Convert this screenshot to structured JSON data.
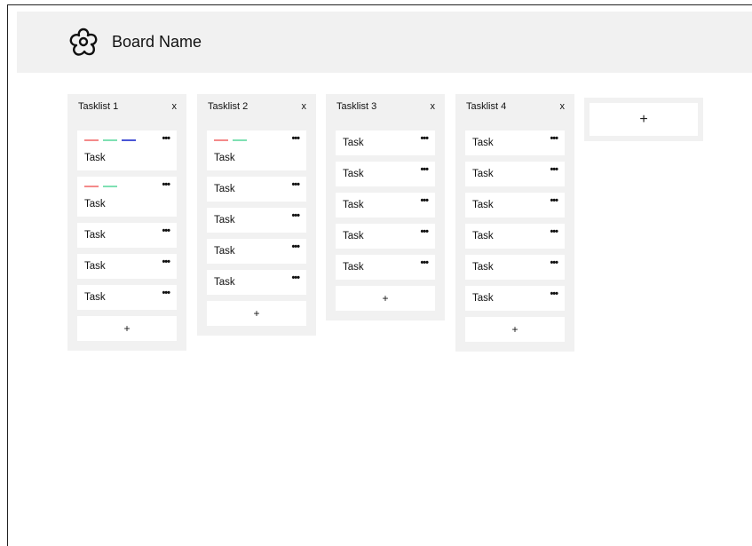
{
  "board": {
    "name": "Board Name",
    "icon": "flower-icon"
  },
  "colors": {
    "red": "#f48a8a",
    "green": "#7fe0b3",
    "blue": "#4a56d6",
    "panel": "#f1f1f1"
  },
  "tasklists": [
    {
      "title": "Tasklist 1",
      "close": "x",
      "add": "+",
      "tasks": [
        {
          "text": "Task",
          "menu": "•••",
          "labels": [
            "#f48a8a",
            "#7fe0b3",
            "#4a56d6"
          ]
        },
        {
          "text": "Task",
          "menu": "•••",
          "labels": [
            "#f48a8a",
            "#7fe0b3"
          ]
        },
        {
          "text": "Task",
          "menu": "•••",
          "labels": []
        },
        {
          "text": "Task",
          "menu": "•••",
          "labels": []
        },
        {
          "text": "Task",
          "menu": "•••",
          "labels": []
        }
      ]
    },
    {
      "title": "Tasklist 2",
      "close": "x",
      "add": "+",
      "tasks": [
        {
          "text": "Task",
          "menu": "•••",
          "labels": [
            "#f48a8a",
            "#7fe0b3"
          ]
        },
        {
          "text": "Task",
          "menu": "•••",
          "labels": []
        },
        {
          "text": "Task",
          "menu": "•••",
          "labels": []
        },
        {
          "text": "Task",
          "menu": "•••",
          "labels": []
        },
        {
          "text": "Task",
          "menu": "•••",
          "labels": []
        }
      ]
    },
    {
      "title": "Tasklist 3",
      "close": "x",
      "add": "+",
      "tasks": [
        {
          "text": "Task",
          "menu": "•••",
          "labels": []
        },
        {
          "text": "Task",
          "menu": "•••",
          "labels": []
        },
        {
          "text": "Task",
          "menu": "•••",
          "labels": []
        },
        {
          "text": "Task",
          "menu": "•••",
          "labels": []
        },
        {
          "text": "Task",
          "menu": "•••",
          "labels": []
        }
      ]
    },
    {
      "title": "Tasklist 4",
      "close": "x",
      "add": "+",
      "tasks": [
        {
          "text": "Task",
          "menu": "•••",
          "labels": []
        },
        {
          "text": "Task",
          "menu": "•••",
          "labels": []
        },
        {
          "text": "Task",
          "menu": "•••",
          "labels": []
        },
        {
          "text": "Task",
          "menu": "•••",
          "labels": []
        },
        {
          "text": "Task",
          "menu": "•••",
          "labels": []
        },
        {
          "text": "Task",
          "menu": "•••",
          "labels": []
        }
      ]
    }
  ],
  "add_list": {
    "label": "+"
  }
}
